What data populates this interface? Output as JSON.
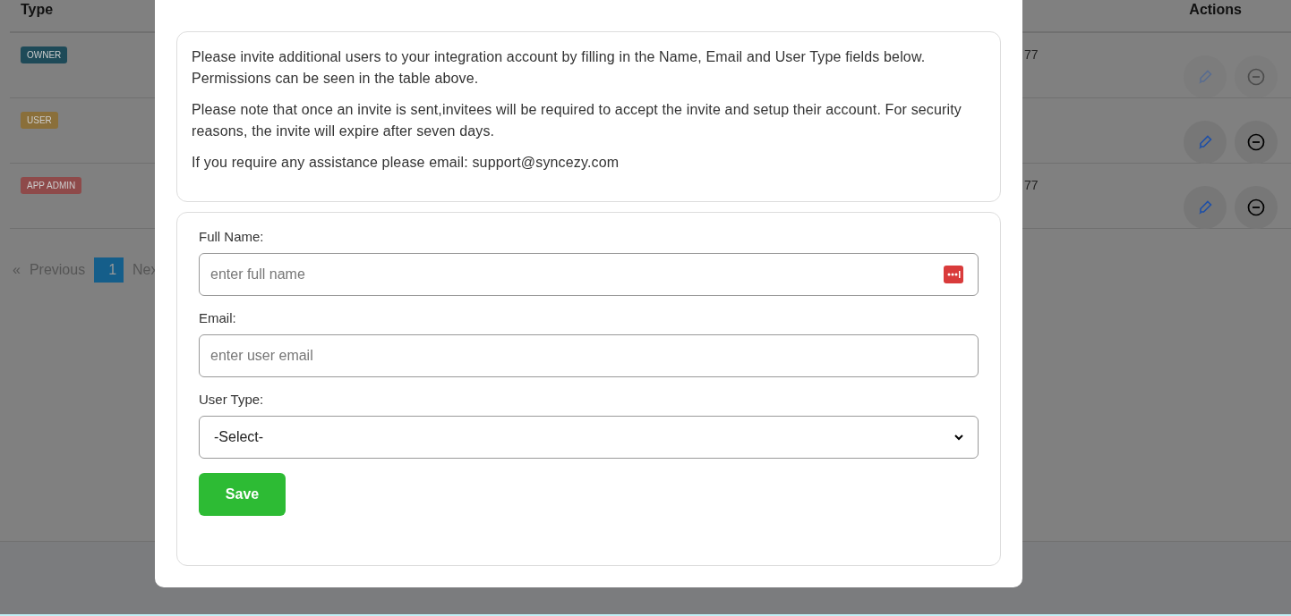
{
  "table": {
    "columns": [
      {
        "label": "Type"
      },
      {
        "label": "Actions"
      }
    ],
    "rows": [
      {
        "type_badge": "OWNER",
        "color": "#1e4a58",
        "column_2": "77",
        "actions_disabled": true
      },
      {
        "type_badge": "USER",
        "color": "#8a6f3a",
        "actions_disabled": false
      },
      {
        "type_badge": "APP ADMIN",
        "color": "#8e4a4a",
        "column_2": "77",
        "actions_disabled": false
      }
    ]
  },
  "pagination": {
    "first": "«",
    "previous": "Previous",
    "pages": [
      {
        "label": "1",
        "selected": true
      }
    ],
    "next": "Nex"
  },
  "modal": {
    "info": [
      "Please invite additional users to your integration account by filling in the Name, Email and User Type fields below. Permissions can be seen in the table above.",
      "Please note that once an invite is sent,invitees will be required to accept the invite and setup their account. For security reasons, the invite will expire after seven days.",
      "If you require any assistance please email: support@syncezy.com"
    ],
    "fields": [
      {
        "kind": "text",
        "label": "Full Name:",
        "placeholder": "enter full name",
        "password_manager_icon": true
      },
      {
        "kind": "text",
        "label": "Email:",
        "placeholder": "enter user email",
        "password_manager_icon": false
      },
      {
        "kind": "select",
        "label": "User Type:",
        "value": "-Select-"
      }
    ],
    "save": "Save"
  }
}
